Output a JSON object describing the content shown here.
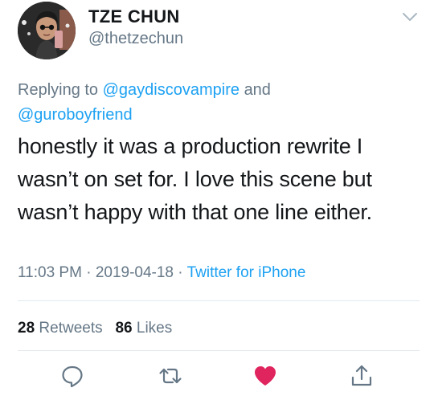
{
  "author": {
    "name": "TZE CHUN",
    "handle": "@thetzechun"
  },
  "reply": {
    "prefix": "Replying to",
    "mention1": "@gaydiscovampire",
    "conjunction": "and",
    "mention2": "@guroboyfriend"
  },
  "tweet": {
    "lines": [
      "honestly it was a production rewrite I",
      "wasn’t on set for. I love this scene but",
      "wasn’t happy with that one line either."
    ]
  },
  "meta": {
    "time": "11:03 PM",
    "date": "2019-04-18",
    "separator": "·",
    "source": "Twitter for iPhone"
  },
  "stats": {
    "retweets_count": "28",
    "retweets_label": "Retweets",
    "likes_count": "86",
    "likes_label": "Likes"
  },
  "actions": {
    "reply_icon": "reply-icon",
    "retweet_icon": "retweet-icon",
    "like_icon": "heart-icon",
    "share_icon": "share-icon",
    "like_color": "#e0245e",
    "icon_color": "#657786"
  },
  "colors": {
    "link": "#1da1f2",
    "secondary": "#657786",
    "text": "#14171a"
  }
}
